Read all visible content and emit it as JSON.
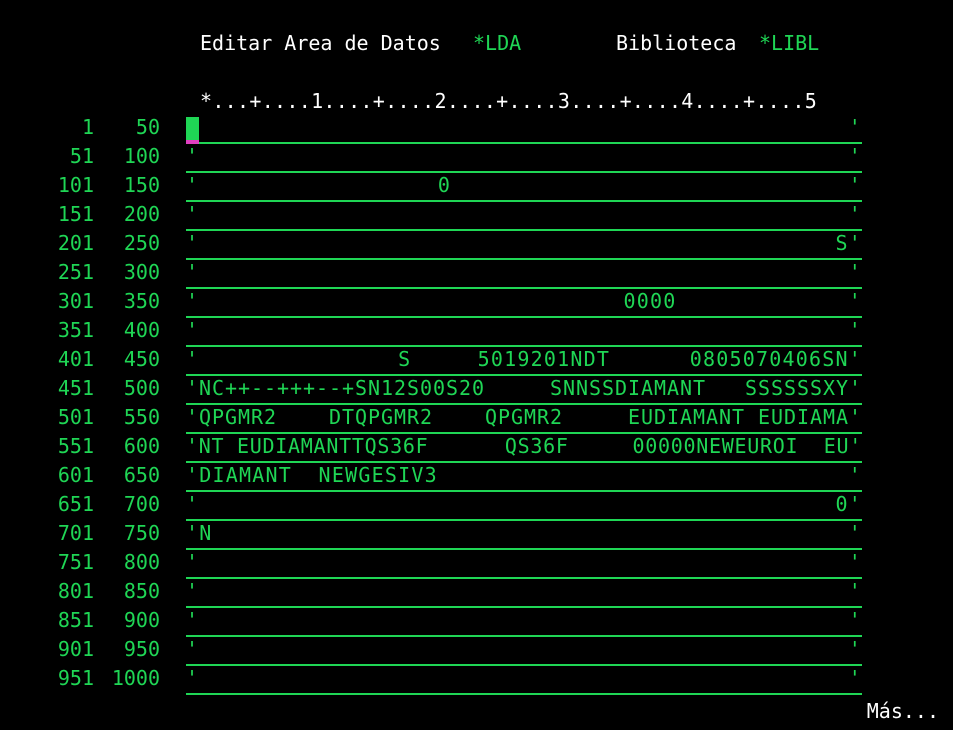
{
  "header": {
    "label_edit": "Editar Area de Datos",
    "area_name": "*LDA",
    "label_library": "Biblioteca",
    "library_name": "*LIBL"
  },
  "ruler": "*...+....1....+....2....+....3....+....4....+....5",
  "rows": [
    {
      "start": "1",
      "end": "50",
      "value": "'                                                 '"
    },
    {
      "start": "51",
      "end": "100",
      "value": "'                                                 '"
    },
    {
      "start": "101",
      "end": "150",
      "value": "'                  0                              '"
    },
    {
      "start": "151",
      "end": "200",
      "value": "'                                                 '"
    },
    {
      "start": "201",
      "end": "250",
      "value": "'                                                S'"
    },
    {
      "start": "251",
      "end": "300",
      "value": "'                                                 '"
    },
    {
      "start": "301",
      "end": "350",
      "value": "'                                0000             '"
    },
    {
      "start": "351",
      "end": "400",
      "value": "'                                                 '"
    },
    {
      "start": "401",
      "end": "450",
      "value": "'               S     5019201NDT      0805070406SN'"
    },
    {
      "start": "451",
      "end": "500",
      "value": "'NC++--+++--+SN12S00S20     SNNSSDIAMANT   SSSSSSXY'"
    },
    {
      "start": "501",
      "end": "550",
      "value": "'QPGMR2    DTQPGMR2    QPGMR2     EUDIAMANT EUDIAMA'"
    },
    {
      "start": "551",
      "end": "600",
      "value": "'NT EUDIAMANTTQS36F      QS36F     00000NEWEUROI  EU'"
    },
    {
      "start": "601",
      "end": "650",
      "value": "'DIAMANT  NEWGESIV3                               '"
    },
    {
      "start": "651",
      "end": "700",
      "value": "'                                                0'"
    },
    {
      "start": "701",
      "end": "750",
      "value": "'N                                                '"
    },
    {
      "start": "751",
      "end": "800",
      "value": "'                                                 '"
    },
    {
      "start": "801",
      "end": "850",
      "value": "'                                                 '"
    },
    {
      "start": "851",
      "end": "900",
      "value": "'                                                 '"
    },
    {
      "start": "901",
      "end": "950",
      "value": "'                                                 '"
    },
    {
      "start": "951",
      "end": "1000",
      "value": "'                                                 '"
    }
  ],
  "footer": {
    "more": "Más..."
  },
  "colors": {
    "field_green": "#1fd655",
    "text_white": "#ffffff",
    "cursor_magenta": "#e040c0",
    "background": "#000000"
  }
}
